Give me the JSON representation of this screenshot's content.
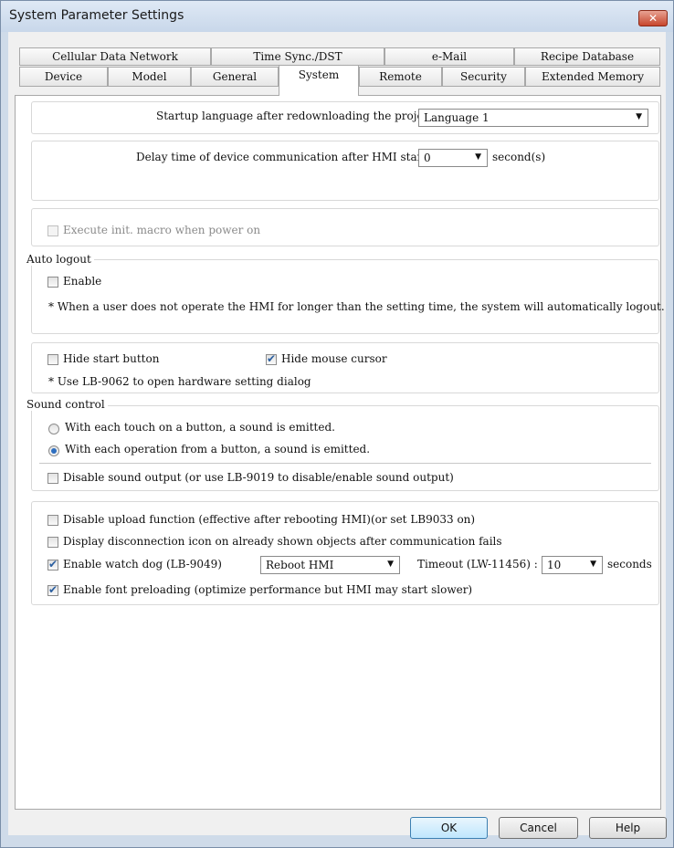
{
  "window": {
    "title": "System Parameter Settings",
    "close_glyph": "✕"
  },
  "tabs": {
    "row1": [
      "Cellular Data Network",
      "Time Sync./DST",
      "e-Mail",
      "Recipe Database"
    ],
    "row2": [
      "Device",
      "Model",
      "General",
      "System",
      "Remote",
      "Security",
      "Extended Memory"
    ],
    "active": "System"
  },
  "startup": {
    "label": "Startup language after redownloading the project :",
    "value": "Language 1"
  },
  "delay": {
    "label": "Delay time of device communication after HMI starts :",
    "value": "0",
    "unit": "second(s)"
  },
  "init_macro": {
    "label": "Execute init. macro when power on",
    "checked": false,
    "enabled": false
  },
  "auto_logout": {
    "legend": "Auto logout",
    "enable_label": "Enable",
    "enable_checked": false,
    "note": "* When a user does not operate the HMI for longer than the setting time, the system will automatically logout."
  },
  "display": {
    "hide_start_label": "Hide start button",
    "hide_start_checked": false,
    "hide_cursor_label": "Hide mouse cursor",
    "hide_cursor_checked": true,
    "note": "* Use LB-9062 to open hardware setting dialog"
  },
  "sound": {
    "legend": "Sound control",
    "option_touch": "With each touch on a button, a sound is emitted.",
    "option_operation": "With each operation from a button, a sound is emitted.",
    "selected": "operation",
    "disable_label": "Disable sound output (or use LB-9019 to disable/enable sound output)",
    "disable_checked": false
  },
  "misc": {
    "disable_upload_label": "Disable upload function (effective after rebooting HMI)(or set LB9033 on)",
    "disable_upload_checked": false,
    "disconnect_icon_label": "Display disconnection icon on already shown objects after communication fails",
    "disconnect_icon_checked": false,
    "watchdog_label": "Enable watch dog (LB-9049)",
    "watchdog_checked": true,
    "watchdog_action": "Reboot HMI",
    "timeout_label": "Timeout (LW-11456) :",
    "timeout_value": "10",
    "timeout_unit": "seconds",
    "font_preload_label": "Enable font preloading (optimize performance but HMI may start slower)",
    "font_preload_checked": true
  },
  "buttons": {
    "ok": "OK",
    "cancel": "Cancel",
    "help": "Help"
  },
  "icons": {
    "check": "checkmark-icon",
    "dropdown": "chevron-down-icon",
    "close": "close-icon",
    "radio": "radio-dot-icon"
  },
  "colors": {
    "title_bar": "#c8d7ea",
    "close_button": "#c7452c",
    "check_blue": "#2b5fa0",
    "window_frame": "#cfdbe9"
  }
}
